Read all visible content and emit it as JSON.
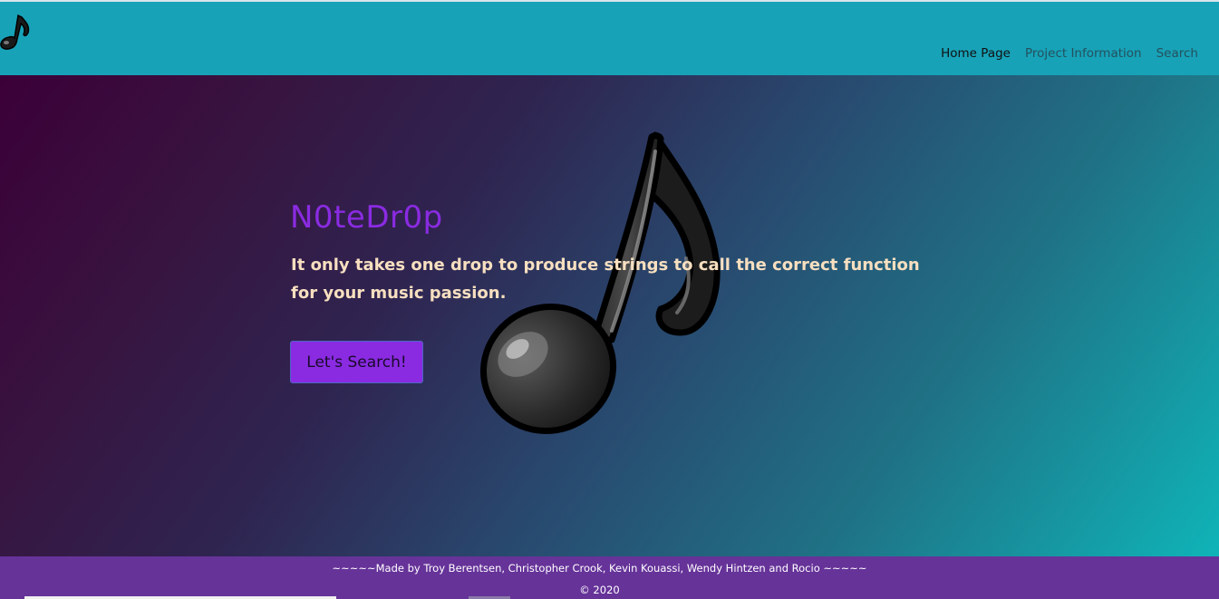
{
  "nav": {
    "brand_icon": "music-note-icon",
    "links": [
      {
        "label": "Home Page",
        "active": true
      },
      {
        "label": "Project Information",
        "active": false
      },
      {
        "label": "Search",
        "active": false
      }
    ]
  },
  "hero": {
    "title": "N0teDr0p",
    "subtitle": "It only takes one drop to produce strings to call the correct function for your music passion.",
    "button_label": "Let's Search!",
    "image_icon": "music-note-icon"
  },
  "footer": {
    "credits": "~~~~~Made by Troy Berentsen, Christopher Crook, Kevin Kouassi, Wendy Hintzen and Rocio ~~~~~",
    "copyright": "© 2020"
  },
  "colors": {
    "navbar": "#17a2b8",
    "accent": "#8a2be2",
    "footer": "#663399",
    "subtitle": "#f7dfc0"
  }
}
